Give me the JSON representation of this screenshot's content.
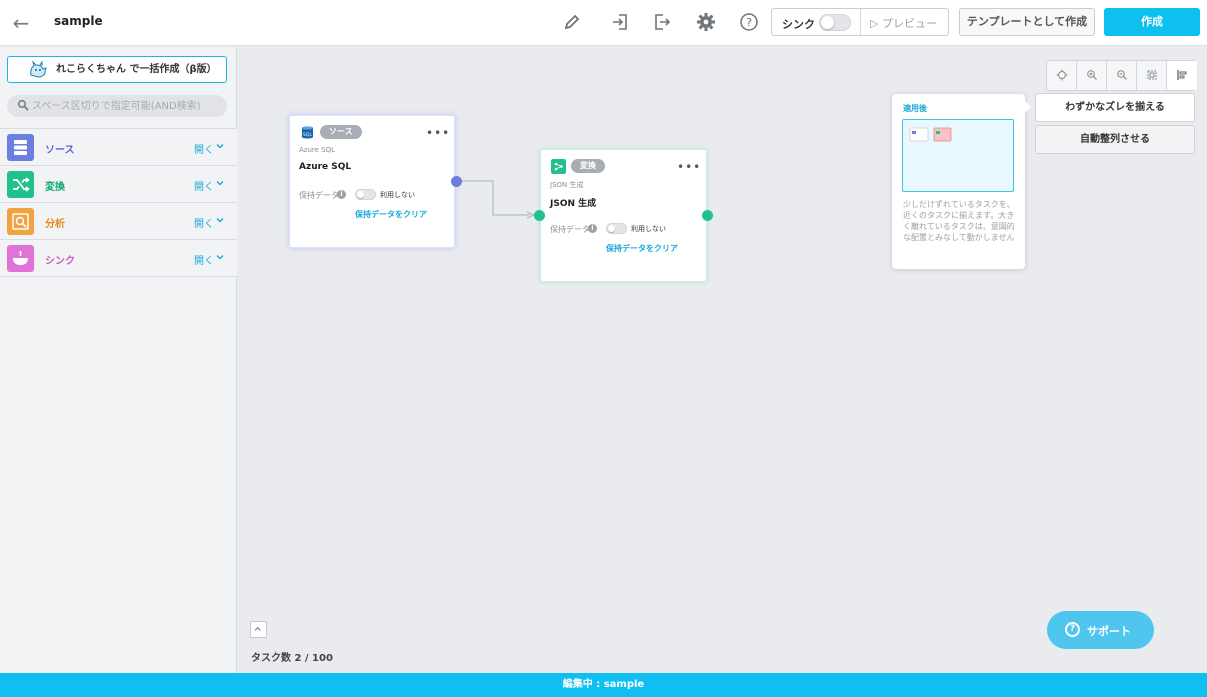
{
  "header": {
    "title": "sample",
    "sync_label": "シンク",
    "preview_label": "プレビュー",
    "template_button": "テンプレートとして作成",
    "create_button": "作成"
  },
  "sidebar": {
    "bulk_button": "れこらくちゃん で一括作成（β版）",
    "search_placeholder": "スペース区切りで指定可能(AND検索)",
    "categories": [
      {
        "label": "ソース",
        "open": "開く",
        "color": "#6b7fe0"
      },
      {
        "label": "変換",
        "open": "開く",
        "color": "#21c18e"
      },
      {
        "label": "分析",
        "open": "開く",
        "color": "#f2a340"
      },
      {
        "label": "シンク",
        "open": "開く",
        "color": "#e073d8"
      }
    ]
  },
  "nodes": [
    {
      "badge": "ソース",
      "subtitle": "Azure SQL",
      "name": "Azure SQL",
      "keep_label": "保持データ",
      "toggle_label": "利用しない",
      "clear_label": "保持データをクリア"
    },
    {
      "badge": "変換",
      "subtitle": "JSON 生成",
      "name": "JSON 生成",
      "keep_label": "保持データ",
      "toggle_label": "利用しない",
      "clear_label": "保持データをクリア"
    }
  ],
  "align_popover": {
    "title": "適用後",
    "description": "少しだけずれているタスクを、近くのタスクに揃えます。大きく離れているタスクは、意図的な配置とみなして動かしません"
  },
  "align_buttons": {
    "slight": "わずかなズレを揃える",
    "auto": "自動整列させる"
  },
  "task_count": "タスク数 2 / 100",
  "support_label": "サポート",
  "footer": "編集中 : sample",
  "colors": {
    "accent": "#10bff2",
    "source_port": "#6b7fe0",
    "transform_port": "#21c18e"
  }
}
